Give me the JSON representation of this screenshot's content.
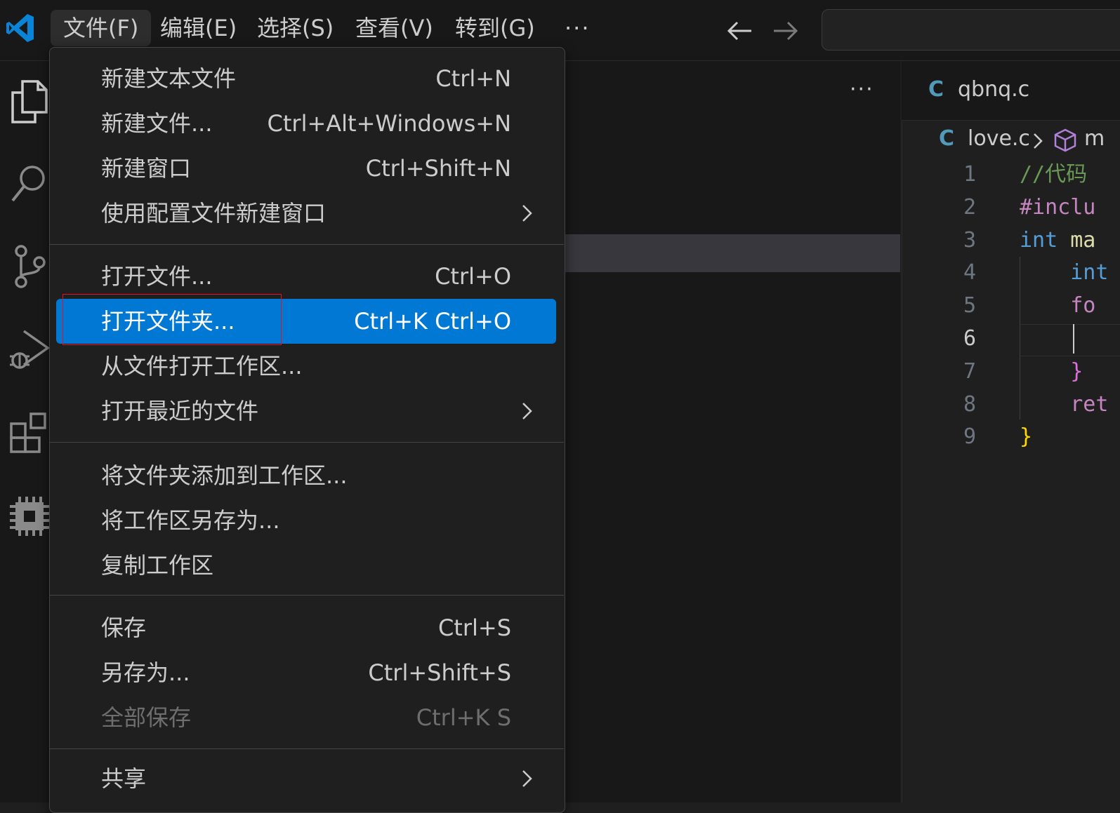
{
  "menubar": {
    "items": [
      "文件(F)",
      "编辑(E)",
      "选择(S)",
      "查看(V)",
      "转到(G)"
    ],
    "overflow": "···",
    "active_index": 0
  },
  "editor": {
    "tab_label": "qbnq.c",
    "tab_icon_letter": "C",
    "breadcrumb_file": "love.c",
    "breadcrumb_next": "m",
    "line_numbers": [
      "1",
      "2",
      "3",
      "4",
      "5",
      "6",
      "7",
      "8",
      "9"
    ],
    "current_line": 6,
    "code": [
      {
        "parts": [
          {
            "t": "//代码",
            "c": "#6a9955"
          }
        ]
      },
      {
        "parts": [
          {
            "t": "#inclu",
            "c": "#c586c0"
          }
        ]
      },
      {
        "parts": [
          {
            "t": "int",
            "c": "#569cd6"
          },
          {
            "t": " ma",
            "c": "#dcdcaa"
          }
        ]
      },
      {
        "parts": [
          {
            "t": "    int",
            "c": "#569cd6"
          }
        ]
      },
      {
        "parts": [
          {
            "t": "    fo",
            "c": "#c586c0"
          }
        ]
      },
      {
        "parts": [
          {
            "t": "",
            "c": "#cccccc"
          }
        ]
      },
      {
        "parts": [
          {
            "t": "    }",
            "c": "#da70d6"
          }
        ]
      },
      {
        "parts": [
          {
            "t": "    ret",
            "c": "#c586c0"
          }
        ]
      },
      {
        "parts": [
          {
            "t": "}",
            "c": "#ffd700"
          }
        ]
      }
    ]
  },
  "more_actions": "···",
  "file_menu": {
    "items": [
      {
        "label": "新建文本文件",
        "shortcut": "Ctrl+N"
      },
      {
        "label": "新建文件...",
        "shortcut": "Ctrl+Alt+Windows+N"
      },
      {
        "label": "新建窗口",
        "shortcut": "Ctrl+Shift+N"
      },
      {
        "label": "使用配置文件新建窗口",
        "shortcut": ""
      },
      {
        "label": "打开文件...",
        "shortcut": "Ctrl+O"
      },
      {
        "label": "打开文件夹...",
        "shortcut": "Ctrl+K Ctrl+O"
      },
      {
        "label": "从文件打开工作区...",
        "shortcut": ""
      },
      {
        "label": "打开最近的文件",
        "shortcut": ""
      },
      {
        "label": "将文件夹添加到工作区...",
        "shortcut": ""
      },
      {
        "label": "将工作区另存为...",
        "shortcut": ""
      },
      {
        "label": "复制工作区",
        "shortcut": ""
      },
      {
        "label": "保存",
        "shortcut": "Ctrl+S"
      },
      {
        "label": "另存为...",
        "shortcut": "Ctrl+Shift+S"
      },
      {
        "label": "全部保存",
        "shortcut": "Ctrl+K S"
      },
      {
        "label": "共享",
        "shortcut": ""
      }
    ],
    "highlighted_index": 5,
    "disabled_index": 13
  },
  "colors": {
    "accent": "#0078d4",
    "annotation_box": "#e81123"
  }
}
